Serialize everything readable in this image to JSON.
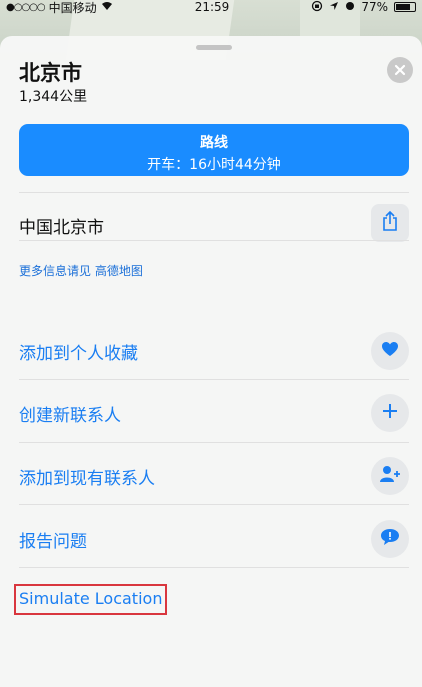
{
  "status_bar": {
    "carrier": "中国移动",
    "time": "21:59",
    "battery": "77%"
  },
  "place": {
    "title": "北京市",
    "distance": "1,344公里"
  },
  "route": {
    "label": "路线",
    "drive_time": "开车：16小时44分钟"
  },
  "address": "中国北京市",
  "more_info": "更多信息请见 高德地图",
  "actions": [
    {
      "label": "添加到个人收藏",
      "icon": "heart-icon"
    },
    {
      "label": "创建新联系人",
      "icon": "plus-icon"
    },
    {
      "label": "添加到现有联系人",
      "icon": "add-person-icon"
    },
    {
      "label": "报告问题",
      "icon": "speech-bubble-icon"
    }
  ],
  "simulate_location": "Simulate Location",
  "colors": {
    "accent": "#1a8cff",
    "link": "#1a7ef2",
    "highlight_box": "#d9363e"
  }
}
